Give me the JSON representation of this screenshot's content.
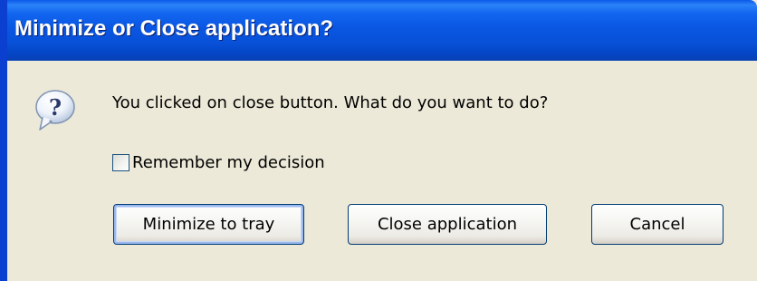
{
  "dialog": {
    "title": "Minimize or Close application?",
    "message": "You clicked on close button. What do you want to do?",
    "icon": "question-bubble-icon",
    "remember": {
      "label": "Remember my decision",
      "checked": false
    },
    "buttons": {
      "minimize": "Minimize to tray",
      "close": "Close application",
      "cancel": "Cancel"
    }
  },
  "colors": {
    "titlebar": "#0a57e3",
    "title_text": "#ffffff",
    "dialog_background": "#ece9d8",
    "button_border": "#003c74"
  }
}
